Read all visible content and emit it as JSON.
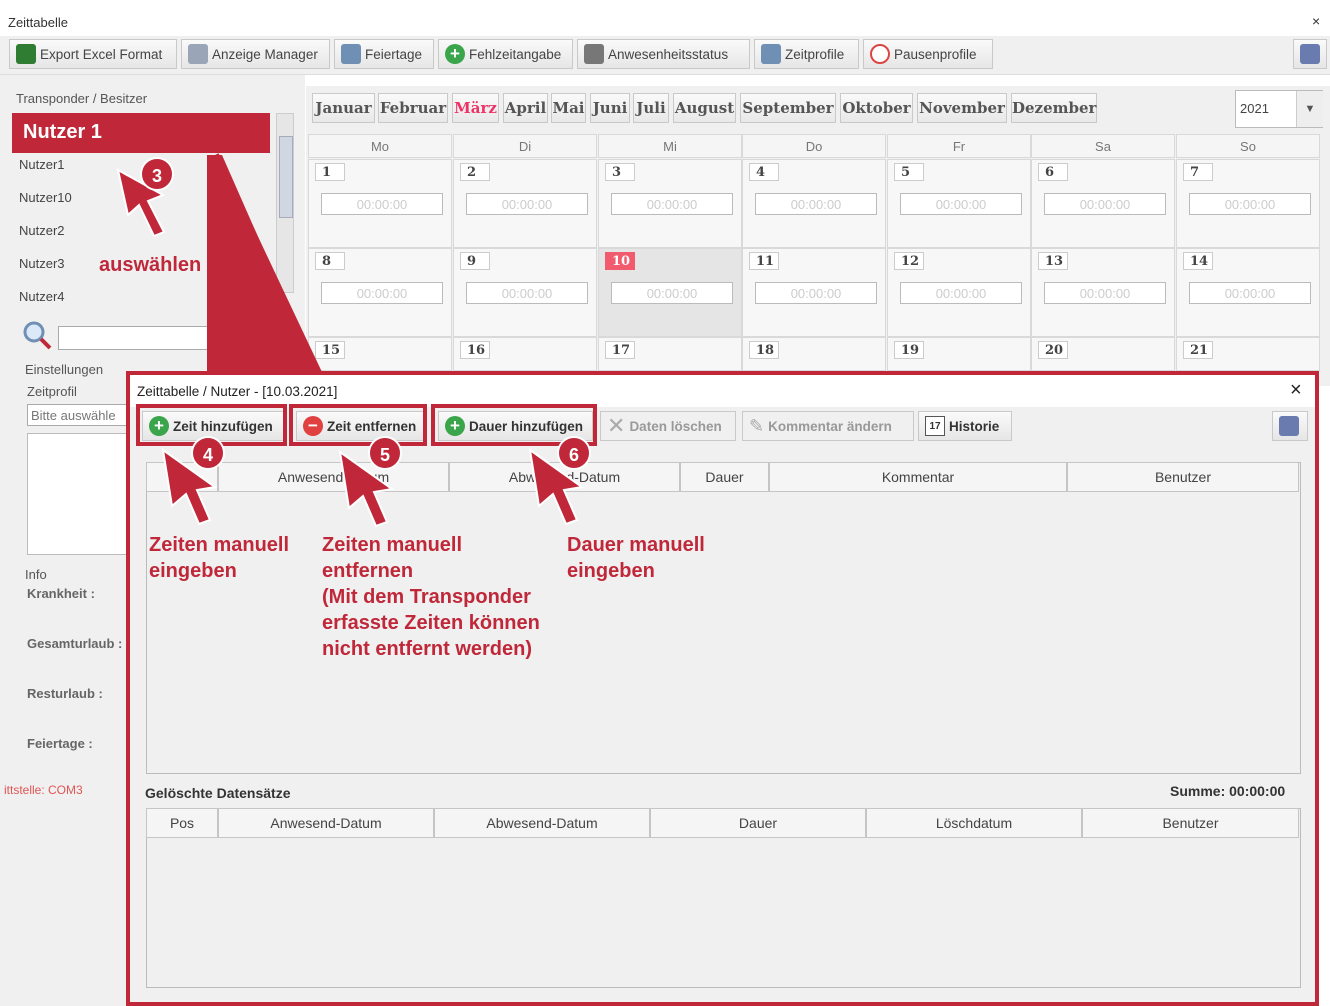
{
  "window": {
    "title": "Zeittabelle",
    "close_glyph": "×"
  },
  "toolbar": {
    "export_excel": "Export Excel Format",
    "anzeige_manager": "Anzeige Manager",
    "feiertage": "Feiertage",
    "fehlzeitangabe": "Fehlzeitangabe",
    "anwesenheitsstatus": "Anwesenheitsstatus",
    "zeitprofile": "Zeitprofile",
    "pausenprofile": "Pausenprofile"
  },
  "sidebar": {
    "section_title": "Transponder / Besitzer",
    "selected_label": "Nutzer 1",
    "users": [
      "Nutzer1",
      "Nutzer10",
      "Nutzer2",
      "Nutzer3",
      "Nutzer4"
    ],
    "settings_title": "Einstellungen",
    "zeitprofil_label": "Zeitprofil",
    "zeitprofil_value": "Bitte auswähle",
    "info_title": "Info",
    "info_labels": [
      "Krankheit :",
      "Gesamturlaub :",
      "Resturlaub :",
      "Feiertage :"
    ],
    "status_text": "ittstelle: COM3"
  },
  "calendar": {
    "months": [
      "Januar",
      "Februar",
      "März",
      "April",
      "Mai",
      "Juni",
      "Juli",
      "August",
      "September",
      "Oktober",
      "November",
      "Dezember"
    ],
    "active_month": "März",
    "year": "2021",
    "weekdays": [
      "Mo",
      "Di",
      "Mi",
      "Do",
      "Fr",
      "Sa",
      "So"
    ],
    "weeks": [
      [
        "1",
        "2",
        "3",
        "4",
        "5",
        "6",
        "7"
      ],
      [
        "8",
        "9",
        "10",
        "11",
        "12",
        "13",
        "14"
      ],
      [
        "15",
        "16",
        "17",
        "18",
        "19",
        "20",
        "21"
      ]
    ],
    "today": "10",
    "time_placeholder": "00:00:00"
  },
  "dialog": {
    "title": "Zeittabelle / Nutzer  - [10.03.2021]",
    "close_glyph": "×",
    "buttons": {
      "zeit_hinzufuegen": "Zeit hinzufügen",
      "zeit_entfernen": "Zeit entfernen",
      "dauer_hinzufuegen": "Dauer hinzufügen",
      "daten_loeschen": "Daten löschen",
      "kommentar_aendern": "Kommentar ändern",
      "historie": "Historie",
      "historie_day": "17"
    },
    "table1_headers": [
      "",
      "Anwesend-Datum",
      "Abwesend-Datum",
      "Dauer",
      "Kommentar",
      "Benutzer"
    ],
    "deleted_title": "Gelöschte Datensätze",
    "summe": "Summe: 00:00:00",
    "table2_headers": [
      "Pos",
      "Anwesend-Datum",
      "Abwesend-Datum",
      "Dauer",
      "Löschdatum",
      "Benutzer"
    ]
  },
  "annotations": {
    "badges": [
      "3",
      "4",
      "5",
      "6"
    ],
    "auswaehlen": "auswählen",
    "zeiten_manuell_eingeben": [
      "Zeiten manuell",
      "eingeben"
    ],
    "zeiten_manuell_entfernen": [
      "Zeiten manuell",
      "entfernen",
      "(Mit dem Transponder",
      "erfasste Zeiten können",
      "nicht entfernt werden)"
    ],
    "dauer_manuell_eingeben": [
      "Dauer manuell",
      "eingeben"
    ],
    "accent_color": "#c0283a"
  }
}
